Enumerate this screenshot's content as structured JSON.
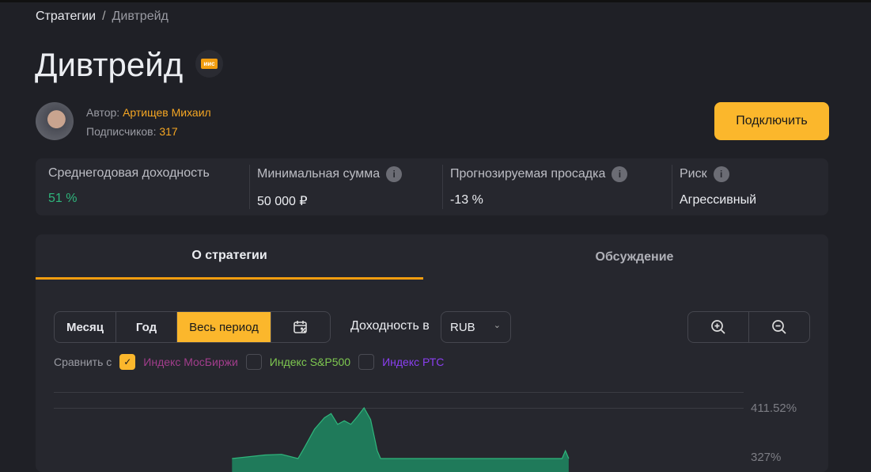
{
  "breadcrumb": {
    "root": "Стратегии",
    "separator": "/",
    "current": "Дивтрейд"
  },
  "title": "Дивтрейд",
  "badge": "иис",
  "author": {
    "label": "Автор:",
    "name": "Артищев Михаил",
    "subs_label": "Подписчиков:",
    "subs": "317"
  },
  "connect_label": "Подключить",
  "stats": [
    {
      "label": "Среднегодовая доходность",
      "value": "51 %",
      "info": false,
      "color": "#2fb67c"
    },
    {
      "label": "Минимальная сумма",
      "value": "50 000 ₽",
      "info": true
    },
    {
      "label": "Прогнозируемая просадка",
      "value": "-13 %",
      "info": true
    },
    {
      "label": "Риск",
      "value": "Агрессивный",
      "info": true
    }
  ],
  "info_glyph": "i",
  "tabs": [
    {
      "label": "О стратегии",
      "active": true
    },
    {
      "label": "Обсуждение",
      "active": false
    }
  ],
  "periods": [
    {
      "label": "Месяц"
    },
    {
      "label": "Год"
    },
    {
      "label": "Весь период",
      "active": true
    }
  ],
  "yield_label": "Доходность в",
  "currency": "RUB",
  "compare": {
    "label": "Сравнить с",
    "items": [
      {
        "label": "Индекс МосБиржи",
        "checked": true,
        "color": "#a23d8c"
      },
      {
        "label": "Индекс S&P500",
        "checked": false,
        "color": "#7ec850"
      },
      {
        "label": "Индекс РТС",
        "checked": false,
        "color": "#8a3ff0"
      }
    ]
  },
  "colors": {
    "accent": "#fbb72c",
    "area": "#1f7a5a",
    "line": "#2fb67c"
  },
  "chart_data": {
    "type": "area",
    "y_ticks": [
      "411.52%",
      "327%"
    ],
    "ylim_visible": [
      327,
      420
    ],
    "series": [
      {
        "name": "Дивтрейд",
        "points": [
          [
            0,
            327
          ],
          [
            10,
            333
          ],
          [
            15,
            334
          ],
          [
            20,
            327
          ],
          [
            22,
            346
          ],
          [
            25,
            376
          ],
          [
            28,
            395
          ],
          [
            30,
            402
          ],
          [
            32,
            384
          ],
          [
            34,
            390
          ],
          [
            36,
            384
          ],
          [
            38,
            397
          ],
          [
            40,
            411.5
          ],
          [
            42,
            392
          ],
          [
            44,
            340
          ],
          [
            45,
            327
          ],
          [
            100,
            327
          ],
          [
            101,
            340
          ],
          [
            102,
            327
          ]
        ]
      }
    ],
    "x_domain": [
      -54,
      155
    ]
  }
}
